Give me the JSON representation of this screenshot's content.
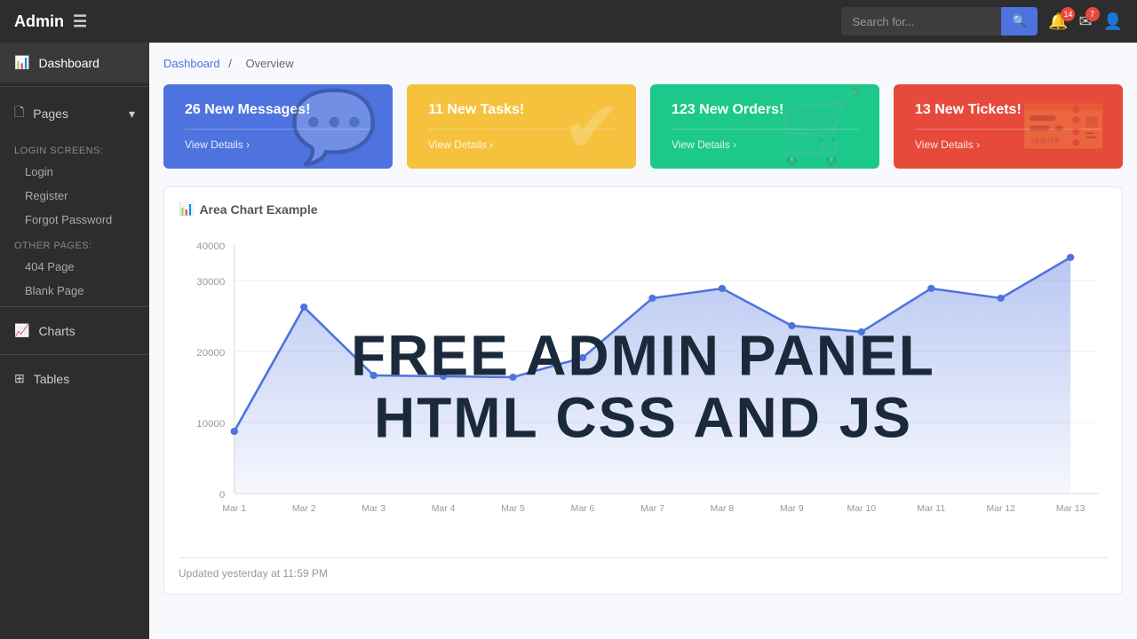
{
  "navbar": {
    "brand": "Admin",
    "hamburger_icon": "☰",
    "search_placeholder": "Search for...",
    "search_label": "Search",
    "notification_count": "14",
    "message_count": "7"
  },
  "sidebar": {
    "dashboard_label": "Dashboard",
    "pages_label": "Pages",
    "pages_icon": "🗋",
    "login_screens_label": "Login Screens:",
    "login_label": "Login",
    "register_label": "Register",
    "forgot_password_label": "Forgot Password",
    "other_pages_label": "Other Pages:",
    "page_404_label": "404 Page",
    "blank_page_label": "Blank Page",
    "charts_label": "Charts",
    "tables_label": "Tables"
  },
  "breadcrumb": {
    "root": "Dashboard",
    "separator": "/",
    "current": "Overview"
  },
  "cards": [
    {
      "title": "26 New Messages!",
      "link": "View Details",
      "color": "card-blue",
      "icon": "💬"
    },
    {
      "title": "11 New Tasks!",
      "link": "View Details",
      "color": "card-yellow",
      "icon": "✔"
    },
    {
      "title": "123 New Orders!",
      "link": "View Details",
      "color": "card-green",
      "icon": "🛒"
    },
    {
      "title": "13 New Tickets!",
      "link": "View Details",
      "color": "card-red",
      "icon": "🎫"
    }
  ],
  "chart": {
    "title": "Area Chart Example",
    "title_icon": "📊",
    "watermark_line1": "FREE ADMIN PANEL",
    "watermark_line2": "HTML CSS AND JS",
    "footer": "Updated yesterday at 11:59 PM",
    "y_labels": [
      "0",
      "10000",
      "20000",
      "30000",
      "40000"
    ],
    "x_labels": [
      "Mar 1",
      "Mar 2",
      "Mar 3",
      "Mar 4",
      "Mar 5",
      "Mar 6",
      "Mar 7",
      "Mar 8",
      "Mar 9",
      "Mar 10",
      "Mar 11",
      "Mar 12",
      "Mar 13"
    ],
    "data_points": [
      10000,
      30200,
      19000,
      18800,
      18700,
      22000,
      31500,
      33000,
      27000,
      26000,
      33000,
      31500,
      38000
    ]
  }
}
